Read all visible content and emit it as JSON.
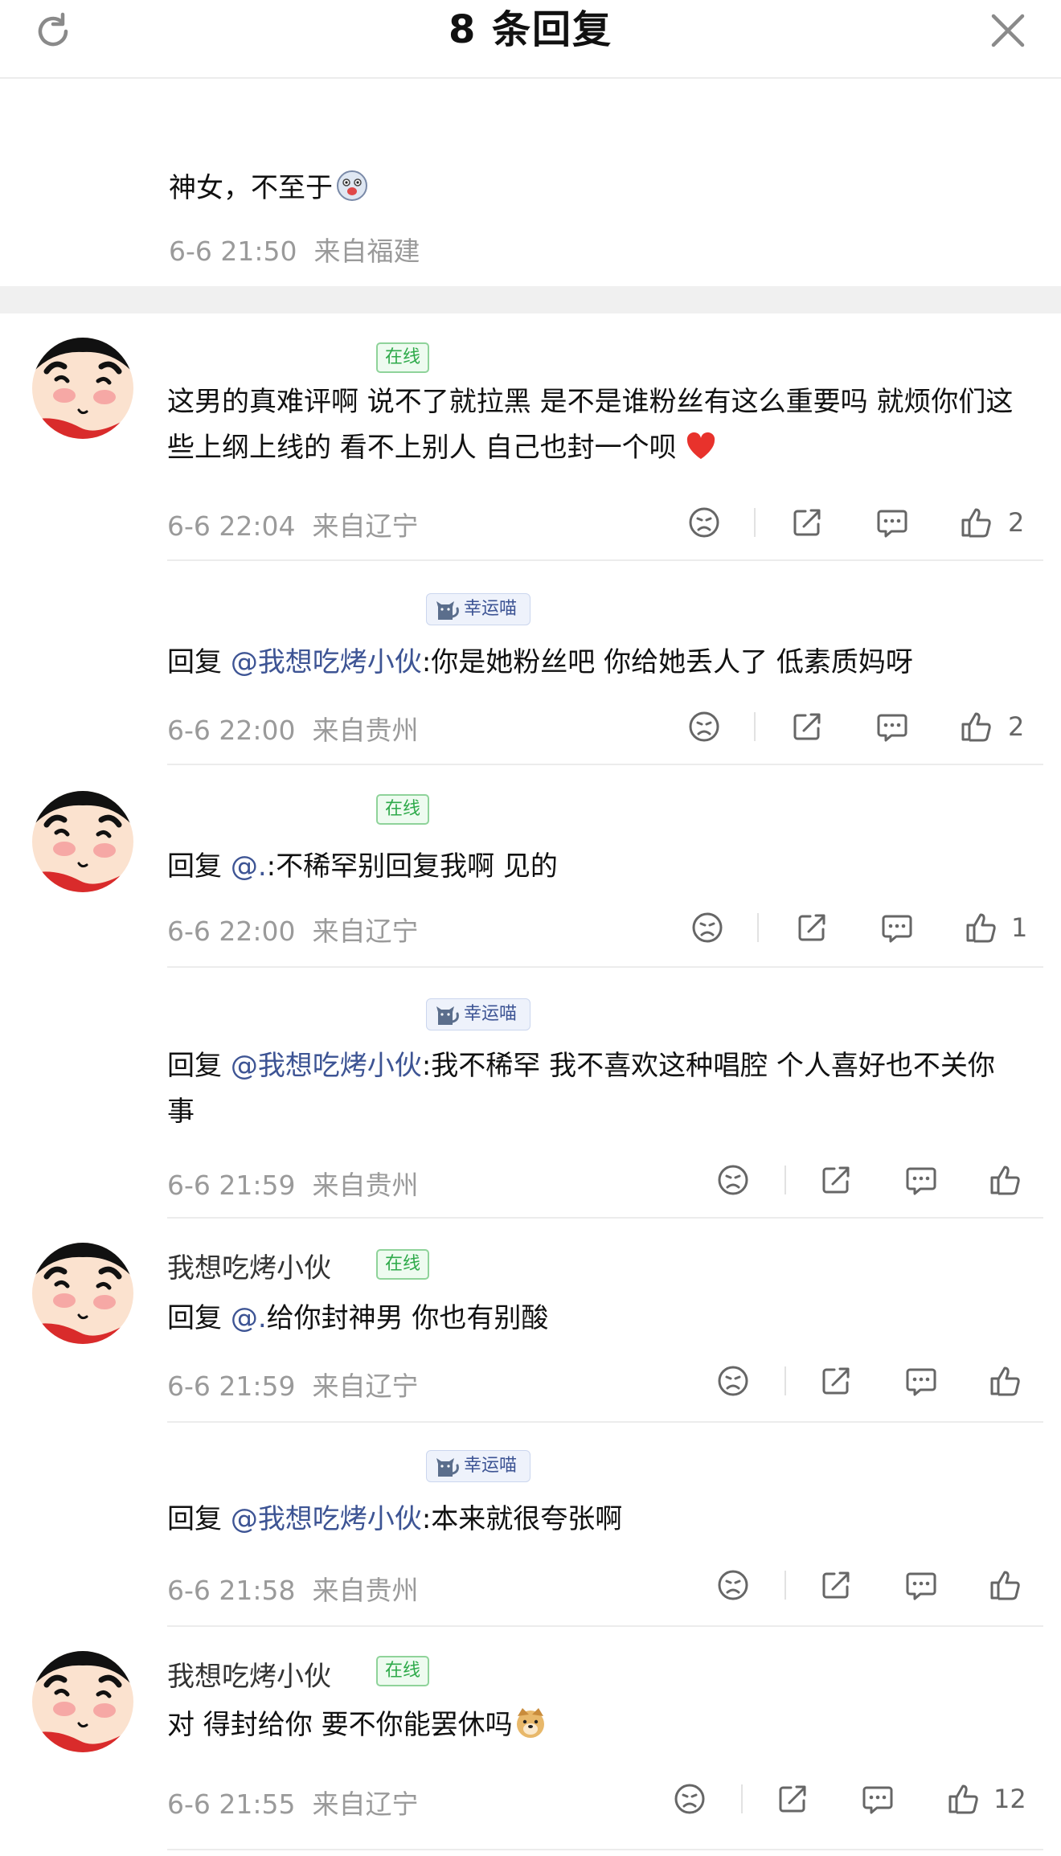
{
  "header": {
    "title": "8 条回复"
  },
  "root": {
    "text": "神女，不至于",
    "time": "6-6 21:50",
    "location": "来自福建"
  },
  "replies": [
    {
      "name": "",
      "badge": "在线",
      "segments": {
        "pre": "这男的真难评啊 说不了就拉黑 是不是谁粉丝有这么重要吗 就烦你们这些上纲上线的 看不上别人 自己也封一个呗"
      },
      "time": "6-6 22:04",
      "location": "来自辽宁",
      "likes": "2"
    },
    {
      "name": "",
      "badge": "幸运喵",
      "segments": {
        "pre": "回复 ",
        "at": "@我想吃烤小伙",
        "post": ":你是她粉丝吧 你给她丢人了 低素质妈呀"
      },
      "time": "6-6 22:00",
      "location": "来自贵州",
      "likes": "2"
    },
    {
      "name": "",
      "badge": "在线",
      "segments": {
        "pre": "回复 ",
        "at": "@.",
        "post": ":不稀罕别回复我啊 见的"
      },
      "time": "6-6 22:00",
      "location": "来自辽宁",
      "likes": "1"
    },
    {
      "name": "",
      "badge": "幸运喵",
      "segments": {
        "pre": "回复 ",
        "at": "@我想吃烤小伙",
        "post": ":我不稀罕 我不喜欢这种唱腔 个人喜好也不关你事"
      },
      "time": "6-6 21:59",
      "location": "来自贵州",
      "likes": ""
    },
    {
      "name": "我想吃烤小伙",
      "badge": "在线",
      "segments": {
        "pre": "回复 ",
        "at": "@.",
        "post": "给你封神男 你也有别酸"
      },
      "time": "6-6 21:59",
      "location": "来自辽宁",
      "likes": ""
    },
    {
      "name": "",
      "badge": "幸运喵",
      "segments": {
        "pre": "回复 ",
        "at": "@我想吃烤小伙",
        "post": ":本来就很夸张啊"
      },
      "time": "6-6 21:58",
      "location": "来自贵州",
      "likes": ""
    },
    {
      "name": "我想吃烤小伙",
      "badge": "在线",
      "segments": {
        "pre": "对 得封给你 要不你能罢休吗"
      },
      "time": "6-6 21:55",
      "location": "来自辽宁",
      "likes": "12"
    }
  ],
  "colors": {
    "link": "#3d5494",
    "online_badge": "#2eaa4a",
    "meta": "#9a9a9a"
  },
  "icons": [
    "refresh-icon",
    "close-icon",
    "dislike-icon",
    "share-icon",
    "comment-icon",
    "like-icon",
    "heart-emoji",
    "dog-emoji",
    "cat-icon"
  ]
}
